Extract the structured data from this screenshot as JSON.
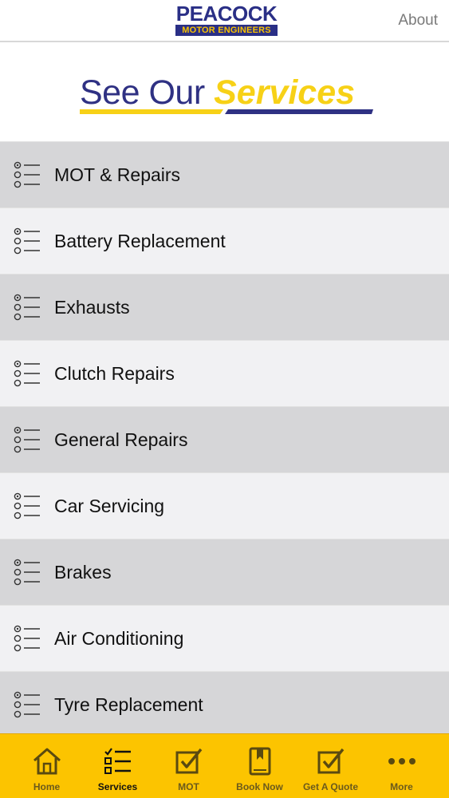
{
  "header": {
    "logo_top": "PEACOCK",
    "logo_bottom": "MOTOR ENGINEERS",
    "about_label": "About"
  },
  "banner": {
    "title_part1": "See Our ",
    "title_part2": "Services"
  },
  "services": [
    {
      "label": "MOT & Repairs",
      "icon": "list-icon"
    },
    {
      "label": "Battery Replacement",
      "icon": "list-icon"
    },
    {
      "label": "Exhausts",
      "icon": "list-icon"
    },
    {
      "label": "Clutch Repairs",
      "icon": "list-icon"
    },
    {
      "label": "General Repairs",
      "icon": "list-icon"
    },
    {
      "label": "Car Servicing",
      "icon": "list-icon"
    },
    {
      "label": "Brakes",
      "icon": "list-icon"
    },
    {
      "label": "Air Conditioning",
      "icon": "list-icon"
    },
    {
      "label": "Tyre Replacement",
      "icon": "list-icon"
    }
  ],
  "tabs": [
    {
      "label": "Home",
      "icon": "house-icon",
      "active": false
    },
    {
      "label": "Services",
      "icon": "checklist-icon",
      "active": true
    },
    {
      "label": "MOT",
      "icon": "checkbox-icon",
      "active": false
    },
    {
      "label": "Book Now",
      "icon": "bookmark-book-icon",
      "active": false
    },
    {
      "label": "Get A Quote",
      "icon": "checkbox-icon",
      "active": false
    },
    {
      "label": "More",
      "icon": "more-dots-icon",
      "active": false
    }
  ],
  "colors": {
    "brand_blue": "#2a2f86",
    "brand_yellow": "#fcc400",
    "row_dark": "#d6d6d8",
    "row_light": "#f1f1f3"
  }
}
